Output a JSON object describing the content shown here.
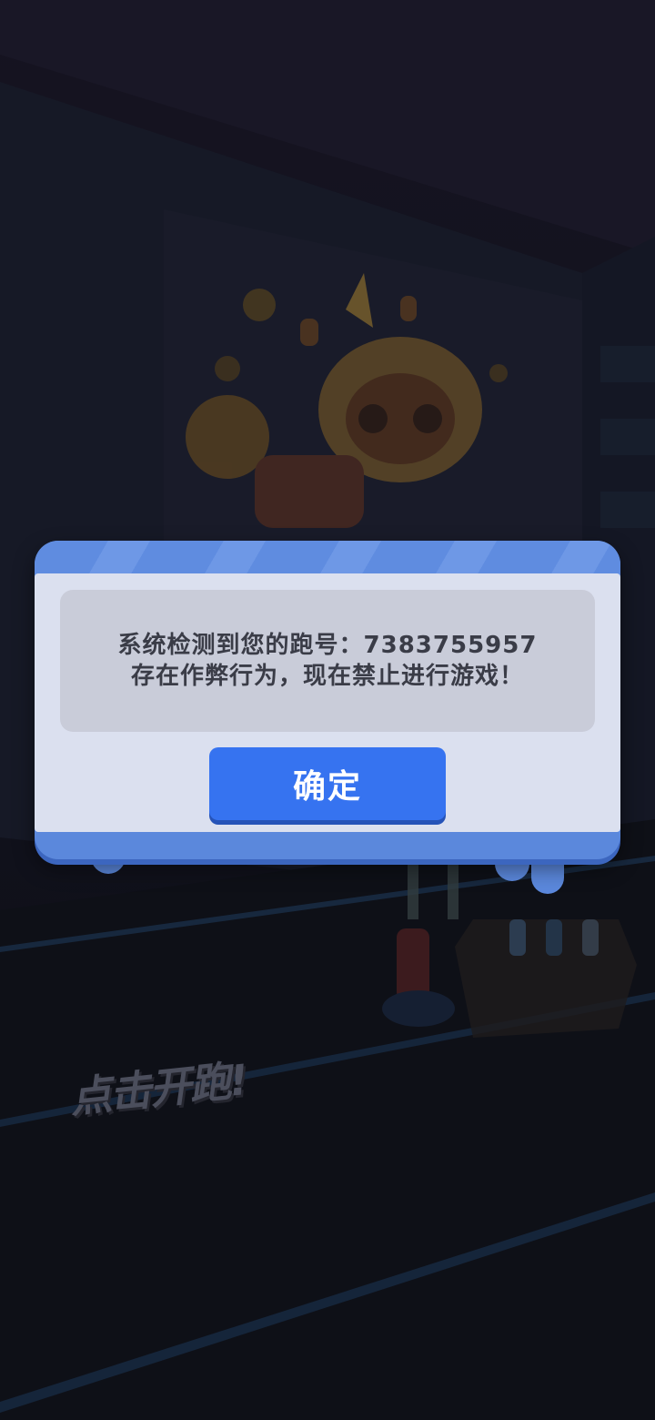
{
  "dialog": {
    "message_line_1": "系统检测到您的跑号：7383755957",
    "message_line_2": "存在作弊行为，现在禁止进行游戏！",
    "confirm_label": "确定"
  },
  "background": {
    "tap_to_run_label": "点击开跑!"
  },
  "colors": {
    "dialog_frame": "#5b88dc",
    "dialog_body": "#dbe0ef",
    "message_box": "#c9ccd9",
    "confirm_button": "#3673f0"
  }
}
